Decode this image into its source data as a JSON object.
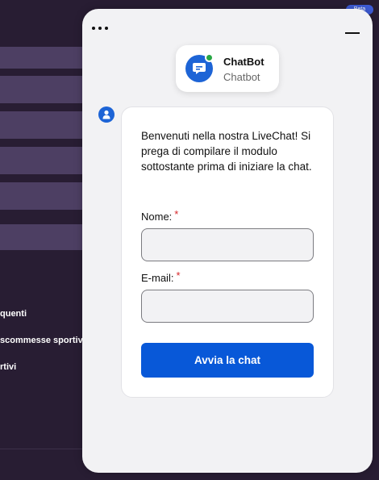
{
  "background": {
    "links": [
      "quenti",
      "scommesse sportiv",
      "rtivi"
    ],
    "badge": "Beta"
  },
  "widget": {
    "agent": {
      "name": "ChatBot",
      "role": "Chatbot",
      "status_color": "#28a745"
    },
    "form": {
      "intro": "Benvenuti nella nostra LiveChat! Si prega di compilare il modulo sottostante prima di iniziare la chat.",
      "name_label": "Nome:",
      "email_label": "E-mail:",
      "required_marker": "*",
      "name_value": "",
      "email_value": "",
      "submit_label": "Avvia la chat"
    },
    "colors": {
      "accent": "#0858d8",
      "required": "#d6272a"
    }
  }
}
